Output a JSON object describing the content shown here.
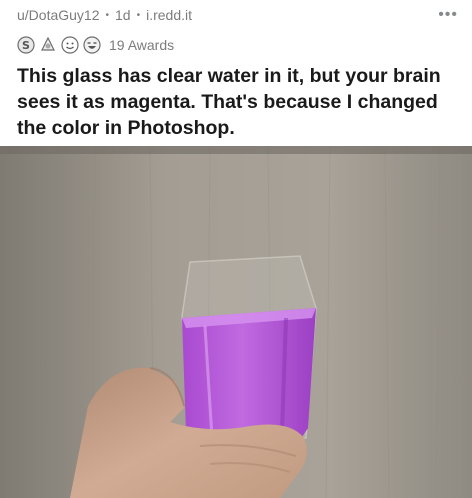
{
  "post": {
    "author": "u/DotaGuy12",
    "separator": "•",
    "age": "1d",
    "domain": "i.redd.it",
    "more_label": "•••",
    "awards_label": "19 Awards",
    "award_icons": [
      "silver-award-icon",
      "helpful-award-icon",
      "wholesome-award-icon",
      "laughing-award-icon"
    ],
    "title": "This glass has clear water in it, but your brain sees it as magenta. That's because I changed the color in Photoshop."
  },
  "image": {
    "subject": "hand-holding-glass",
    "colors": {
      "wall": "#9b958b",
      "liquid": "#b45dd8",
      "skin": "#cfa890"
    }
  }
}
